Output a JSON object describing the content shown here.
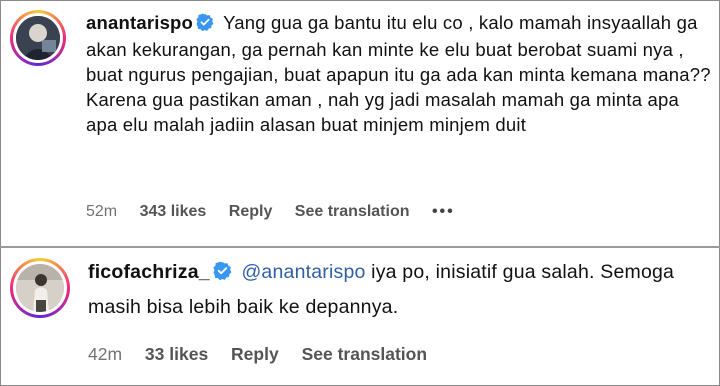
{
  "comments": [
    {
      "username": "anantarispo",
      "text": "Yang gua ga bantu itu elu co , kalo mamah insyaallah ga akan kekurangan, ga pernah kan minte ke elu buat berobat suami nya , buat ngurus pengajian, buat apapun itu ga ada kan minta kemana mana?? Karena gua pastikan aman , nah yg jadi masalah mamah ga minta apa apa elu malah jadiin alasan buat minjem minjem duit",
      "time": "52m",
      "likes": "343 likes",
      "reply": "Reply",
      "translate": "See translation",
      "more": "•••"
    },
    {
      "username": "ficofachriza_",
      "mention": "@anantarispo",
      "text": " iya po, inisiatif gua salah. Semoga masih bisa lebih baik ke depannya.",
      "time": "42m",
      "likes": "33 likes",
      "reply": "Reply",
      "translate": "See translation"
    }
  ],
  "colors": {
    "verified": "#3897f0",
    "mention": "#2f5fa6",
    "meta": "#737373"
  }
}
